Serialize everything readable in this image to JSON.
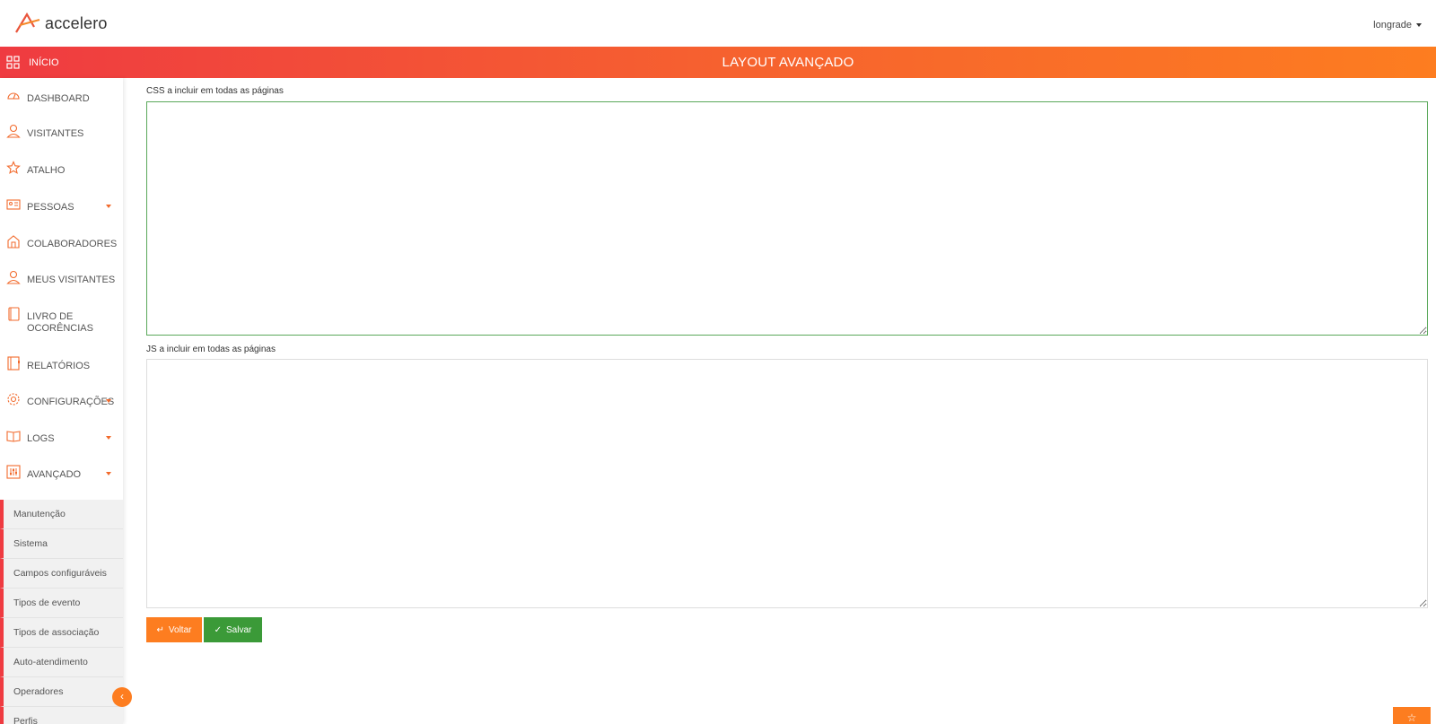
{
  "app": {
    "brand": "accelero",
    "user": "longrade"
  },
  "band": {
    "home_label": "INÍCIO",
    "page_title": "LAYOUT AVANÇADO"
  },
  "sidebar": {
    "items": [
      {
        "label": "DASHBOARD",
        "icon": "dashboard-icon",
        "dropdown": false
      },
      {
        "label": "VISITANTES",
        "icon": "user-icon",
        "dropdown": false
      },
      {
        "label": "ATALHO",
        "icon": "star-icon",
        "dropdown": false
      },
      {
        "label": "PESSOAS",
        "icon": "id-card-icon",
        "dropdown": true
      },
      {
        "label": "COLABORADORES",
        "icon": "building-icon",
        "dropdown": false
      },
      {
        "label": "MEUS VISITANTES",
        "icon": "user-icon",
        "dropdown": false
      },
      {
        "label": "LIVRO DE OCORÊNCIAS",
        "icon": "book-icon",
        "dropdown": false
      },
      {
        "label": "RELATÓRIOS",
        "icon": "report-icon",
        "dropdown": false
      },
      {
        "label": "CONFIGURAÇÕES",
        "icon": "gear-icon",
        "dropdown": true
      },
      {
        "label": "LOGS",
        "icon": "open-book-icon",
        "dropdown": true
      },
      {
        "label": "AVANÇADO",
        "icon": "sliders-icon",
        "dropdown": true
      }
    ],
    "sub_items": [
      "Manutenção",
      "Sistema",
      "Campos configuráveis",
      "Tipos de evento",
      "Tipos de associação",
      "Auto-atendimento",
      "Operadores",
      "Perfis"
    ]
  },
  "form": {
    "css_label": "CSS a incluir em todas as páginas",
    "css_value": "",
    "js_label": "JS a incluir em todas as páginas",
    "js_value": "",
    "back_label": "Voltar",
    "save_label": "Salvar"
  },
  "colors": {
    "accent_orange": "#fd7d20",
    "accent_red": "#ef3b41",
    "save_green": "#3b9a38"
  }
}
